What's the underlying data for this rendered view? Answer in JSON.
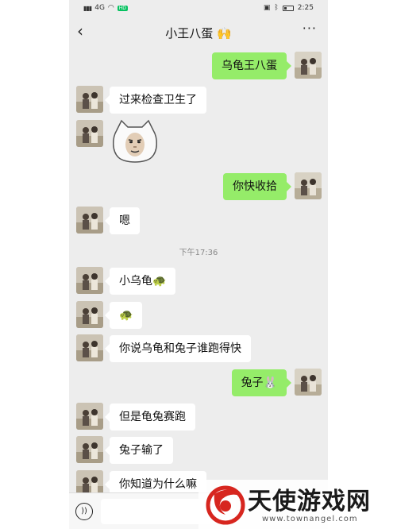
{
  "status_bar": {
    "left": "4G",
    "hd": "HD",
    "time": "2:25"
  },
  "header": {
    "title": "小王八蛋 🙌",
    "back_icon": "chevron-left-icon",
    "more_label": "···"
  },
  "messages": [
    {
      "side": "right",
      "text": "乌龟王八蛋"
    },
    {
      "side": "left",
      "text": "过来检查卫生了"
    },
    {
      "side": "left",
      "type": "sticker",
      "icon": "cat-face-sticker"
    },
    {
      "side": "right",
      "text": "你快收拾"
    },
    {
      "side": "left",
      "text": "嗯"
    },
    {
      "type": "timestamp",
      "text": "下午17:36"
    },
    {
      "side": "left",
      "text": "小乌龟🐢"
    },
    {
      "side": "left",
      "text": "🐢"
    },
    {
      "side": "left",
      "text": "你说乌龟和兔子谁跑得快"
    },
    {
      "side": "right",
      "text": "兔子🐰"
    },
    {
      "side": "left",
      "text": "但是龟兔赛跑"
    },
    {
      "side": "left",
      "text": "兔子输了"
    },
    {
      "side": "left",
      "text": "你知道为什么嘛"
    }
  ],
  "input_bar": {
    "voice_icon": "voice-icon",
    "text_value": ""
  },
  "watermark": {
    "brand": "天使游戏网",
    "url": "www.townangel.com",
    "colors": {
      "logo_red": "#d7261f"
    }
  },
  "colors": {
    "chat_bg": "#ededed",
    "bubble_self": "#95ec69",
    "bubble_other": "#ffffff"
  }
}
